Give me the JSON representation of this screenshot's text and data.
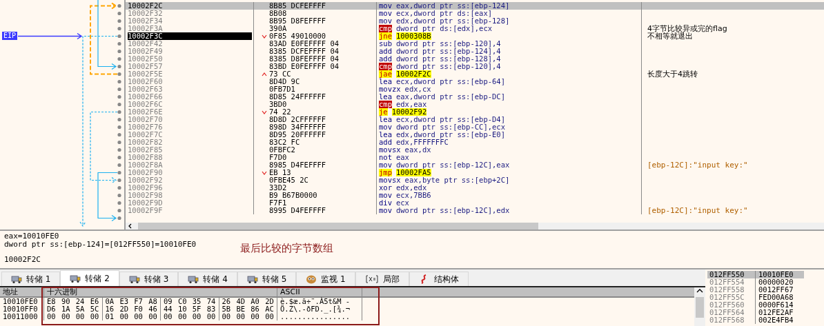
{
  "disassembly": {
    "eip_label": "EIP",
    "rows": [
      {
        "address": "10002F2C",
        "bytes": "8B85 DCFEFFFF",
        "mnemonic": "mov",
        "kind": "plain",
        "operands": "eax,dword ptr ss:[ebp-124]",
        "selected": true,
        "eip": false
      },
      {
        "address": "10002F32",
        "bytes": "8B08",
        "mnemonic": "mov",
        "kind": "plain",
        "operands": "ecx,dword ptr ds:[eax]",
        "selected": false,
        "eip": false
      },
      {
        "address": "10002F34",
        "bytes": "8B95 D8FEFFFF",
        "mnemonic": "mov",
        "kind": "plain",
        "operands": "edx,dword ptr ss:[ebp-128]",
        "selected": false,
        "eip": false
      },
      {
        "address": "10002F3A",
        "bytes": "390A",
        "mnemonic": "cmp",
        "kind": "compare",
        "operands": "dword ptr ds:[edx],ecx",
        "comment": "4字节比较异或完的flag",
        "auto_comment": false,
        "selected": false,
        "eip": false
      },
      {
        "address": "10002F3C",
        "bytes": "0F85 49010000",
        "mnemonic": "jne",
        "kind": "jump",
        "operands": "1000308B",
        "jump_back": false,
        "comment": "不相等就退出",
        "auto_comment": false,
        "selected": false,
        "eip": true
      },
      {
        "address": "10002F42",
        "bytes": "83AD E0FEFFFF 04",
        "mnemonic": "sub",
        "kind": "plain",
        "operands": "dword ptr ss:[ebp-120],4",
        "selected": false,
        "eip": false
      },
      {
        "address": "10002F49",
        "bytes": "8385 DCFEFFFF 04",
        "mnemonic": "add",
        "kind": "plain",
        "operands": "dword ptr ss:[ebp-124],4",
        "selected": false,
        "eip": false
      },
      {
        "address": "10002F50",
        "bytes": "8385 D8FEFFFF 04",
        "mnemonic": "add",
        "kind": "plain",
        "operands": "dword ptr ss:[ebp-128],4",
        "selected": false,
        "eip": false
      },
      {
        "address": "10002F57",
        "bytes": "83BD E0FEFFFF 04",
        "mnemonic": "cmp",
        "kind": "compare",
        "operands": "dword ptr ss:[ebp-120],4",
        "selected": false,
        "eip": false
      },
      {
        "address": "10002F5E",
        "bytes": "73 CC",
        "mnemonic": "jae",
        "kind": "jump",
        "operands": "10002F2C",
        "jump_back": true,
        "comment": "长度大于4跳转",
        "auto_comment": false,
        "selected": false,
        "eip": false
      },
      {
        "address": "10002F60",
        "bytes": "8D4D 9C",
        "mnemonic": "lea",
        "kind": "plain",
        "operands": "ecx,dword ptr ss:[ebp-64]",
        "selected": false,
        "eip": false
      },
      {
        "address": "10002F63",
        "bytes": "0FB7D1",
        "mnemonic": "movzx",
        "kind": "plain",
        "operands": "edx,cx",
        "selected": false,
        "eip": false
      },
      {
        "address": "10002F66",
        "bytes": "8D85 24FFFFFF",
        "mnemonic": "lea",
        "kind": "plain",
        "operands": "eax,dword ptr ss:[ebp-DC]",
        "selected": false,
        "eip": false
      },
      {
        "address": "10002F6C",
        "bytes": "3BD0",
        "mnemonic": "cmp",
        "kind": "compare",
        "operands": "edx,eax",
        "selected": false,
        "eip": false
      },
      {
        "address": "10002F6E",
        "bytes": "74 22",
        "mnemonic": "je",
        "kind": "jump",
        "operands": "10002F92",
        "jump_back": false,
        "selected": false,
        "eip": false
      },
      {
        "address": "10002F70",
        "bytes": "8D8D 2CFFFFFF",
        "mnemonic": "lea",
        "kind": "plain",
        "operands": "ecx,dword ptr ss:[ebp-D4]",
        "selected": false,
        "eip": false
      },
      {
        "address": "10002F76",
        "bytes": "898D 34FFFFFF",
        "mnemonic": "mov",
        "kind": "plain",
        "operands": "dword ptr ss:[ebp-CC],ecx",
        "selected": false,
        "eip": false
      },
      {
        "address": "10002F7C",
        "bytes": "8D95 20FFFFFF",
        "mnemonic": "lea",
        "kind": "plain",
        "operands": "edx,dword ptr ss:[ebp-E0]",
        "selected": false,
        "eip": false
      },
      {
        "address": "10002F82",
        "bytes": "83C2 FC",
        "mnemonic": "add",
        "kind": "plain",
        "operands": "edx,FFFFFFFC",
        "selected": false,
        "eip": false
      },
      {
        "address": "10002F85",
        "bytes": "0FBFC2",
        "mnemonic": "movsx",
        "kind": "plain",
        "operands": "eax,dx",
        "selected": false,
        "eip": false
      },
      {
        "address": "10002F88",
        "bytes": "F7D0",
        "mnemonic": "not",
        "kind": "plain",
        "operands": "eax",
        "selected": false,
        "eip": false
      },
      {
        "address": "10002F8A",
        "bytes": "8985 D4FEFFFF",
        "mnemonic": "mov",
        "kind": "plain",
        "operands": "dword ptr ss:[ebp-12C],eax",
        "comment": "[ebp-12C]:\"input key:\"",
        "auto_comment": true,
        "selected": false,
        "eip": false
      },
      {
        "address": "10002F90",
        "bytes": "EB 13",
        "mnemonic": "jmp",
        "kind": "jump",
        "operands": "10002FA5",
        "jump_back": false,
        "selected": false,
        "eip": false
      },
      {
        "address": "10002F92",
        "bytes": "0FBE45 2C",
        "mnemonic": "movsx",
        "kind": "plain",
        "operands": "eax,byte ptr ss:[ebp+2C]",
        "selected": false,
        "eip": false
      },
      {
        "address": "10002F96",
        "bytes": "33D2",
        "mnemonic": "xor",
        "kind": "plain",
        "operands": "edx,edx",
        "selected": false,
        "eip": false
      },
      {
        "address": "10002F98",
        "bytes": "B9 B67B0000",
        "mnemonic": "mov",
        "kind": "plain",
        "operands": "ecx,7BB6",
        "selected": false,
        "eip": false
      },
      {
        "address": "10002F9D",
        "bytes": "F7F1",
        "mnemonic": "div",
        "kind": "plain",
        "operands": "ecx",
        "selected": false,
        "eip": false
      },
      {
        "address": "10002F9F",
        "bytes": "8995 D4FEFFFF",
        "mnemonic": "mov",
        "kind": "plain",
        "operands": "dword ptr ss:[ebp-12C],edx",
        "comment": "[ebp-12C]:\"input key:\"",
        "auto_comment": true,
        "selected": false,
        "eip": false
      }
    ]
  },
  "info": {
    "lines": [
      "eax=10010FE0",
      "dword ptr ss:[ebp-124]=[012FF550]=10010FE0"
    ],
    "address": "10002F2C"
  },
  "annotation": {
    "text": "最后比较的字节数组"
  },
  "tabs": [
    {
      "label": "转储 1",
      "kind": "dump",
      "selected": false
    },
    {
      "label": "转储 2",
      "kind": "dump",
      "selected": true
    },
    {
      "label": "转储 3",
      "kind": "dump",
      "selected": false
    },
    {
      "label": "转储 4",
      "kind": "dump",
      "selected": false
    },
    {
      "label": "转储 5",
      "kind": "dump",
      "selected": false
    },
    {
      "label": "监视 1",
      "kind": "watch",
      "selected": false
    },
    {
      "label": "局部",
      "kind": "locals",
      "selected": false
    },
    {
      "label": "结构体",
      "kind": "struct",
      "selected": false
    }
  ],
  "dump": {
    "columns": [
      "地址",
      "十六进制",
      "ASCII"
    ],
    "rows": [
      {
        "address": "10010FE0",
        "hex": "E8 90 24 E6 0A E3 F7 A8 09 C0 35 74 26 4D A0 2D",
        "ascii": "è.$æ.ã÷¨.À5t&M -"
      },
      {
        "address": "10010FF0",
        "hex": "D6 1A 5A 5C 16 2D F0 46 44 10 5F 83 5B BE 86 AC",
        "ascii": "Ö.Z\\.-ðFD._.[¾.¬"
      },
      {
        "address": "10011000",
        "hex": "00 00 00 00 01 00 00 00 00 00 00 00 00 00 00 00",
        "ascii": "................"
      }
    ]
  },
  "stack": {
    "rows": [
      {
        "address": "012FF550",
        "value": "10010FE0",
        "selected": true
      },
      {
        "address": "012FF554",
        "value": "00000020",
        "selected": false
      },
      {
        "address": "012FF558",
        "value": "0012FF67",
        "selected": false
      },
      {
        "address": "012FF55C",
        "value": "FED00A68",
        "selected": false
      },
      {
        "address": "012FF560",
        "value": "0000F614",
        "selected": false
      },
      {
        "address": "012FF564",
        "value": "012FE2AF",
        "selected": false
      },
      {
        "address": "012FF568",
        "value": "002E4FB4",
        "selected": false
      }
    ]
  }
}
